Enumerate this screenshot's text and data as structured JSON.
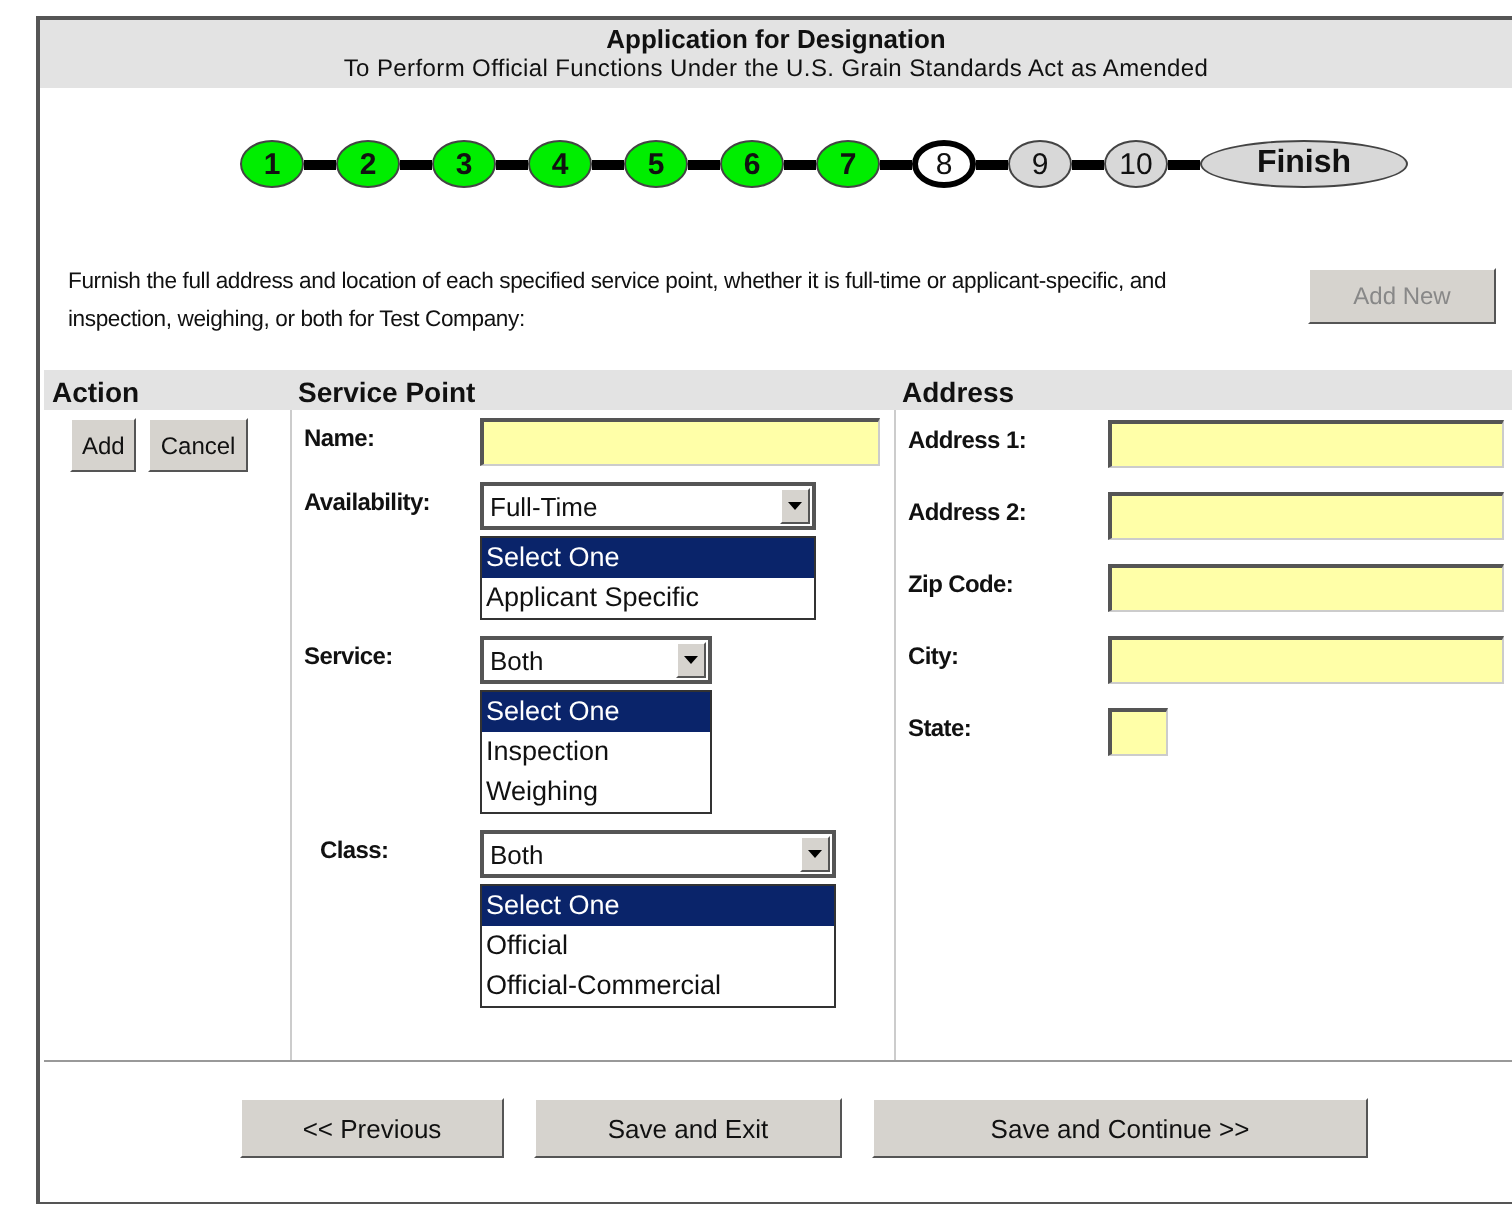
{
  "header": {
    "title": "Application for Designation",
    "subtitle": "To Perform Official Functions Under the U.S. Grain Standards Act as Amended"
  },
  "steps": [
    {
      "label": "1",
      "done": true,
      "current": false
    },
    {
      "label": "2",
      "done": true,
      "current": false
    },
    {
      "label": "3",
      "done": true,
      "current": false
    },
    {
      "label": "4",
      "done": true,
      "current": false
    },
    {
      "label": "5",
      "done": true,
      "current": false
    },
    {
      "label": "6",
      "done": true,
      "current": false
    },
    {
      "label": "7",
      "done": true,
      "current": false
    },
    {
      "label": "8",
      "done": false,
      "current": true
    },
    {
      "label": "9",
      "done": false,
      "current": false
    },
    {
      "label": "10",
      "done": false,
      "current": false
    },
    {
      "label": "Finish",
      "done": false,
      "current": false
    }
  ],
  "instructions": "Furnish the full address and location of each specified service point, whether it is full-time or applicant-specific, and inspection, weighing, or both for Test Company:",
  "add_new_button": {
    "label": "Add New",
    "disabled": true
  },
  "table": {
    "columns": [
      "Action",
      "Service Point",
      "Address"
    ],
    "actions": [
      "Add",
      "Cancel"
    ],
    "service_point": [
      {
        "kind": "text",
        "label": "Name:"
      },
      {
        "kind": "select",
        "label": "Availability:",
        "value": "Full-Time",
        "options": [
          {
            "label": "Select One",
            "selected": true
          },
          {
            "label": "Applicant Specific",
            "selected": false
          }
        ]
      },
      {
        "kind": "select",
        "label": "Service:",
        "value": "Both",
        "options": [
          {
            "label": "Select One",
            "selected": true
          },
          {
            "label": "Inspection",
            "selected": false
          },
          {
            "label": "Weighing",
            "selected": false
          }
        ]
      },
      {
        "kind": "select",
        "label": "Class:",
        "value": "Both",
        "options": [
          {
            "label": "Select One",
            "selected": true
          },
          {
            "label": "Official",
            "selected": false
          },
          {
            "label": "Official-Commercial",
            "selected": false
          }
        ]
      }
    ],
    "address": [
      {
        "label": "Address 1:",
        "kind": "wide"
      },
      {
        "label": "Address 2:",
        "kind": "wide"
      },
      {
        "label": "Zip Code:",
        "kind": "wide"
      },
      {
        "label": "City:",
        "kind": "wide"
      },
      {
        "label": "State:",
        "kind": "short"
      }
    ]
  },
  "footer_buttons": [
    "<< Previous",
    "Save and Exit",
    "Save and Continue >>"
  ]
}
